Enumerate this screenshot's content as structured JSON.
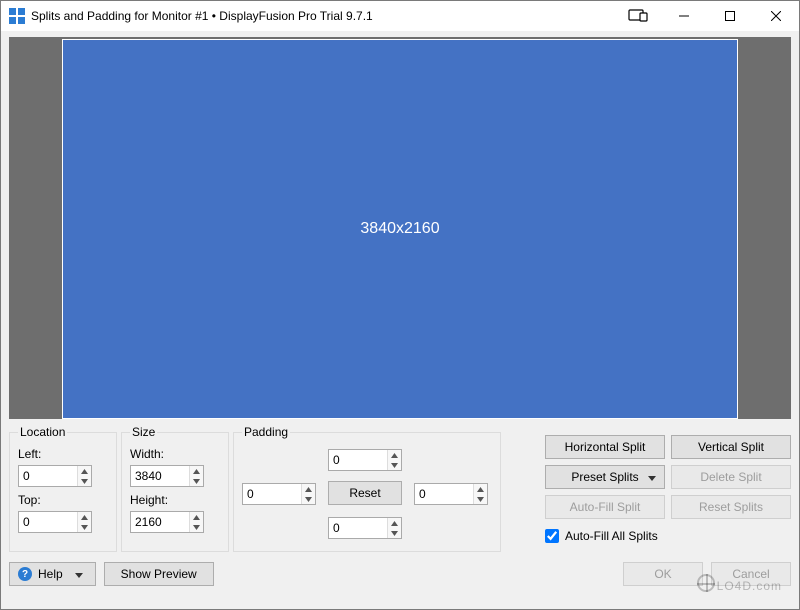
{
  "window": {
    "title": "Splits and Padding for Monitor #1 • DisplayFusion Pro Trial 9.7.1"
  },
  "preview": {
    "resolution": "3840x2160"
  },
  "location": {
    "legend": "Location",
    "left_label": "Left:",
    "left_value": "0",
    "top_label": "Top:",
    "top_value": "0"
  },
  "size": {
    "legend": "Size",
    "width_label": "Width:",
    "width_value": "3840",
    "height_label": "Height:",
    "height_value": "2160"
  },
  "padding": {
    "legend": "Padding",
    "top": "0",
    "left": "0",
    "right": "0",
    "bottom": "0",
    "reset_label": "Reset"
  },
  "buttons": {
    "horizontal_split": "Horizontal Split",
    "vertical_split": "Vertical Split",
    "preset_splits": "Preset Splits",
    "delete_split": "Delete Split",
    "auto_fill_split": "Auto-Fill Split",
    "reset_splits": "Reset Splits",
    "auto_fill_all": "Auto-Fill All Splits"
  },
  "footer": {
    "help": "Help",
    "show_preview": "Show Preview",
    "ok": "OK",
    "cancel": "Cancel"
  },
  "watermark": "LO4D.com"
}
